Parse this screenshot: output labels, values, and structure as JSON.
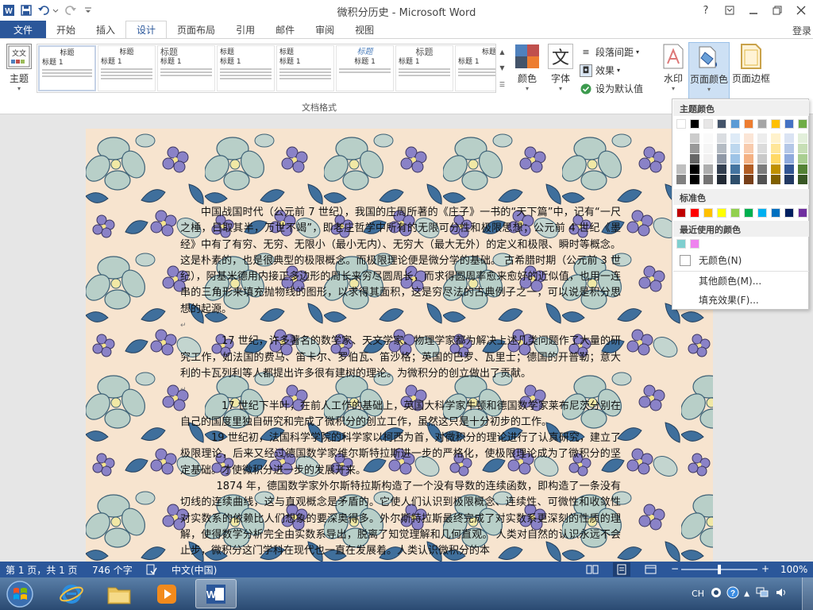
{
  "window": {
    "title": "微积分历史 - Microsoft Word",
    "help": "?",
    "login": "登录"
  },
  "tabs": {
    "file": "文件",
    "items": [
      "开始",
      "插入",
      "设计",
      "页面布局",
      "引用",
      "邮件",
      "审阅",
      "视图"
    ],
    "active": "设计"
  },
  "ribbon": {
    "theme": "主题",
    "gallery_items": [
      {
        "title": "标题",
        "sub": "标题 1"
      },
      {
        "title": "标题",
        "sub": "标题 1"
      },
      {
        "title": "标题",
        "sub": "标题 1"
      },
      {
        "title": "标题",
        "sub": "标题 1"
      },
      {
        "title": "标题",
        "sub": "标题 1"
      },
      {
        "title": "标题",
        "sub": "标题 1"
      },
      {
        "title": "标题",
        "sub": "标题 1"
      },
      {
        "title": "标题",
        "sub": "标题 1"
      }
    ],
    "group_label": "文档格式",
    "colors": "颜色",
    "fonts": "字体",
    "fonts_glyph": "文",
    "paragraph_spacing": "段落间距",
    "effects": "效果",
    "set_default": "设为默认值",
    "watermark": "水印",
    "page_color": "页面颜色",
    "page_borders": "页面边框"
  },
  "color_menu": {
    "theme_colors_label": "主题颜色",
    "standard_colors_label": "标准色",
    "recent_colors_label": "最近使用的颜色",
    "no_color": "无颜色(N)",
    "more_colors": "其他颜色(M)...",
    "fill_effects": "填充效果(F)...",
    "theme_colors": [
      "#ffffff",
      "#000000",
      "#e7e6e6",
      "#44546a",
      "#5b9bd5",
      "#ed7d31",
      "#a5a5a5",
      "#ffc000",
      "#4472c4",
      "#70ad47"
    ],
    "standard_colors": [
      "#c00000",
      "#ff0000",
      "#ffc000",
      "#ffff00",
      "#92d050",
      "#00b050",
      "#00b0f0",
      "#0070c0",
      "#002060",
      "#7030a0"
    ],
    "recent_colors": [
      "#7fcfcf",
      "#ee82ee"
    ]
  },
  "document": {
    "paragraphs": [
      {
        "type": "text",
        "text": "中国战国时代（公元前 7 世纪），我国的庄周所著的《庄子》一书的“天下篇”中，记有“一尺之棰，日取其半，万世不竭”，即老庄哲学中所有的无限可分性和极限思想；公元前 4 世纪《墨经》中有了有穷、无穷、无限小（最小无内）、无穷大（最大无外）的定义和极限、瞬时等概念。这是朴素的，也是很典型的极限概念。而极限理论便是微分学的基础。    古希腊时期（公元前 3 世纪），阿基米德用内接正多边形的周长来穷尽圆周长，而求得圆周率愈来愈好的近似值，也用一连串的三角形来填充抛物线的图形，以求得其面积，这是穷尽法的古典例子之一，可以说是积分思想的起源。"
      },
      {
        "type": "gap",
        "text": "↵"
      },
      {
        "type": "text",
        "text": "17 世纪，许多著名的数学家、天文学家、物理学家都为解决上述几类问题作了大量的研究工作，如法国的费马、笛卡尔、罗伯瓦、笛沙格；英国的巴罗、瓦里士；德国的开普勒；意大利的卡瓦列利等人都提出许多很有建树的理论。为微积分的创立做出了贡献。"
      },
      {
        "type": "gap",
        "text": "↵"
      },
      {
        "type": "text",
        "text": "17 世纪下半叶，在前人工作的基础上，英国大科学家牛顿和德国数学家莱布尼茨分别在自己的国度里独自研究和完成了微积分的创立工作，虽然这只是十分初步的工作。"
      },
      {
        "type": "text",
        "text": "19 世纪初，法国科学学院的科学家以柯西为首，对微积分的理论进行了认真研究，建立了极限理论，后来又经过德国数学家维尔斯特拉斯进一步的严格化，使极限理论成为了微积分的坚定基础。才使微积分进一步的发展开来。"
      },
      {
        "type": "text",
        "text": "1874 年，德国数学家外尔斯特拉斯构造了一个没有导数的连续函数，即构造了一条没有切线的连续曲线，这与直观概念是矛盾的。它使人们认识到极限概念、连续性、可微性和收敛性对实数系的依赖比人们想象的要深奥得多。外尔斯特拉斯最终完成了对实数系更深刻的性质的理解，使得数学分析完全由实数系导出，脱离了知觉理解和几何直观。    人类对自然的认识永远不会止步，微积分这门学科在现代也一直在发展着。人类认识微积分的本"
      }
    ]
  },
  "status": {
    "page": "第 1 页，共 1 页",
    "words": "746 个字",
    "language": "中文(中国)",
    "zoom": "100%",
    "zoom_value": 100
  },
  "taskbar": {
    "lang": "CH",
    "app_word": "W"
  }
}
